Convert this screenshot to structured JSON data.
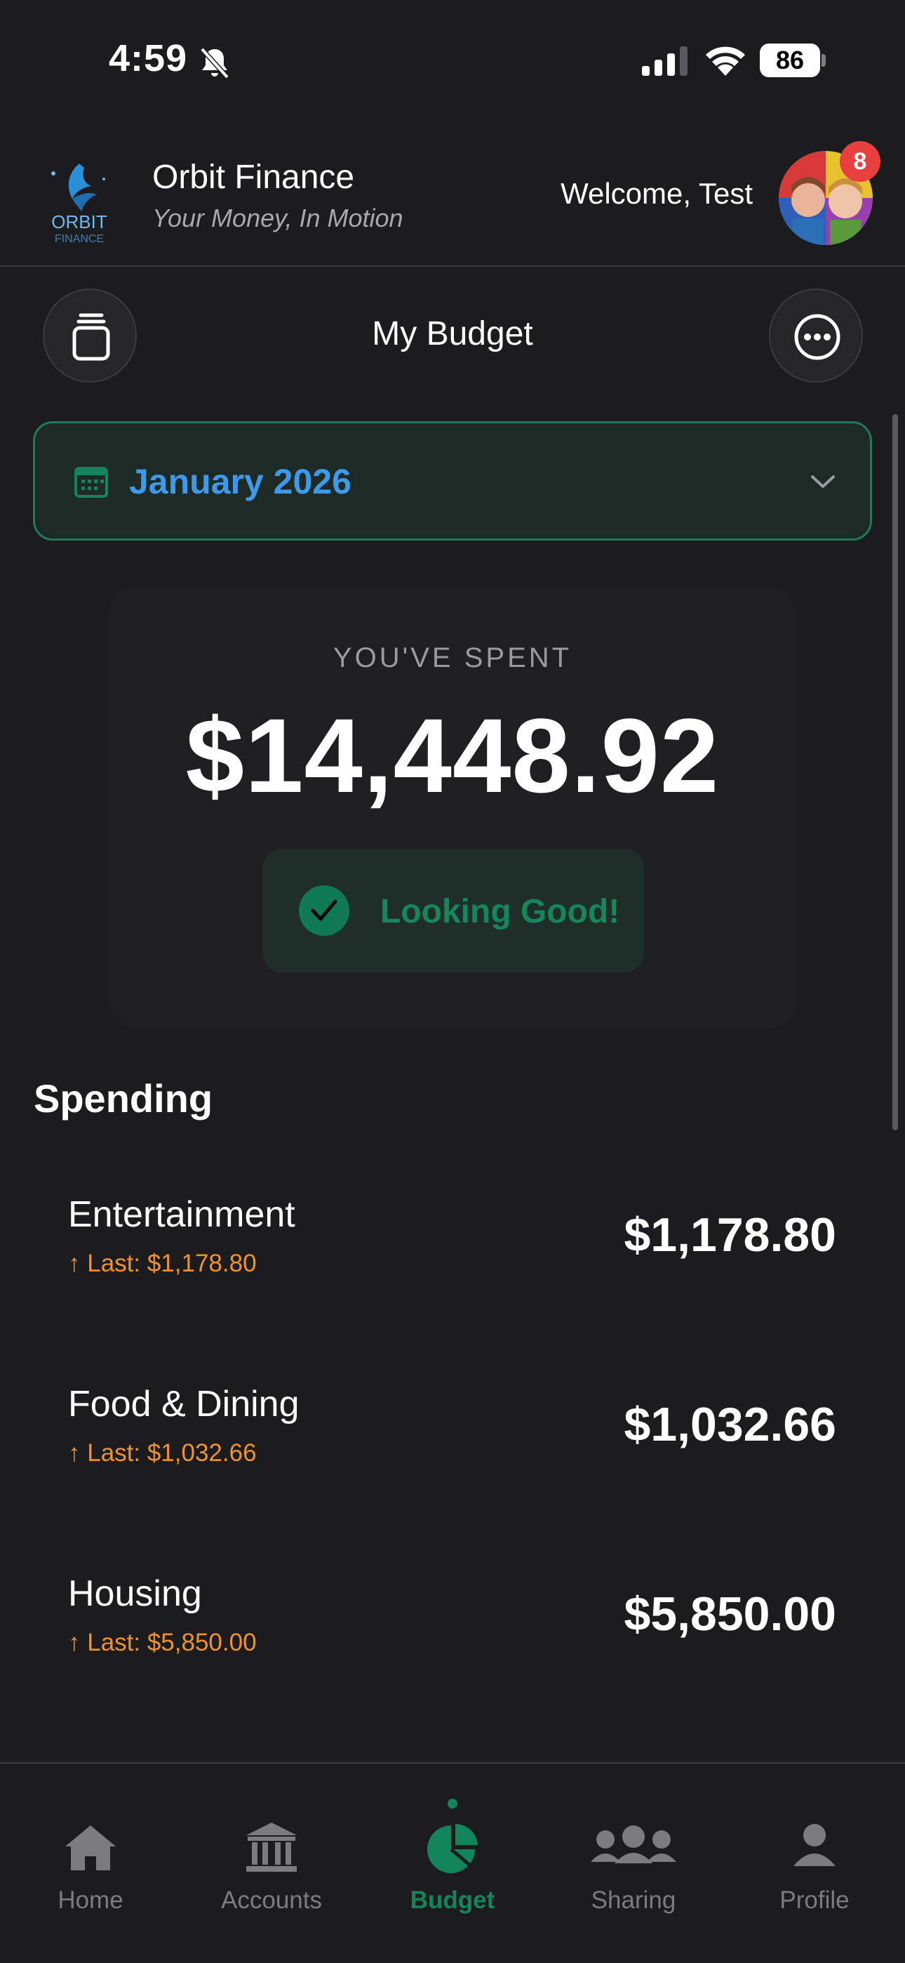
{
  "status_bar": {
    "time": "4:59",
    "battery": "86"
  },
  "header": {
    "app_name": "Orbit Finance",
    "tagline": "Your Money, In Motion",
    "logo_text": "ORBIT",
    "logo_subtext": "FINANCE",
    "welcome": "Welcome, Test",
    "notification_count": "8"
  },
  "budget": {
    "title": "My Budget",
    "month": "January 2026",
    "spent_label": "YOU'VE SPENT",
    "spent_amount": "$14,448.92",
    "status": "Looking Good!"
  },
  "spending": {
    "title": "Spending",
    "items": [
      {
        "name": "Entertainment",
        "last": "↑ Last: $1,178.80",
        "amount": "$1,178.80"
      },
      {
        "name": "Food & Dining",
        "last": "↑ Last: $1,032.66",
        "amount": "$1,032.66"
      },
      {
        "name": "Housing",
        "last": "↑ Last: $5,850.00",
        "amount": "$5,850.00"
      }
    ]
  },
  "tabs": [
    {
      "label": "Home",
      "icon": "home-icon"
    },
    {
      "label": "Accounts",
      "icon": "bank-icon"
    },
    {
      "label": "Budget",
      "icon": "pie-chart-icon",
      "active": true
    },
    {
      "label": "Sharing",
      "icon": "people-icon"
    },
    {
      "label": "Profile",
      "icon": "person-icon"
    }
  ],
  "colors": {
    "accent_green": "#12855c",
    "accent_blue": "#3c9ae8",
    "warning_orange": "#f0922e",
    "badge_red": "#e8403e",
    "background": "#1c1c1e"
  }
}
